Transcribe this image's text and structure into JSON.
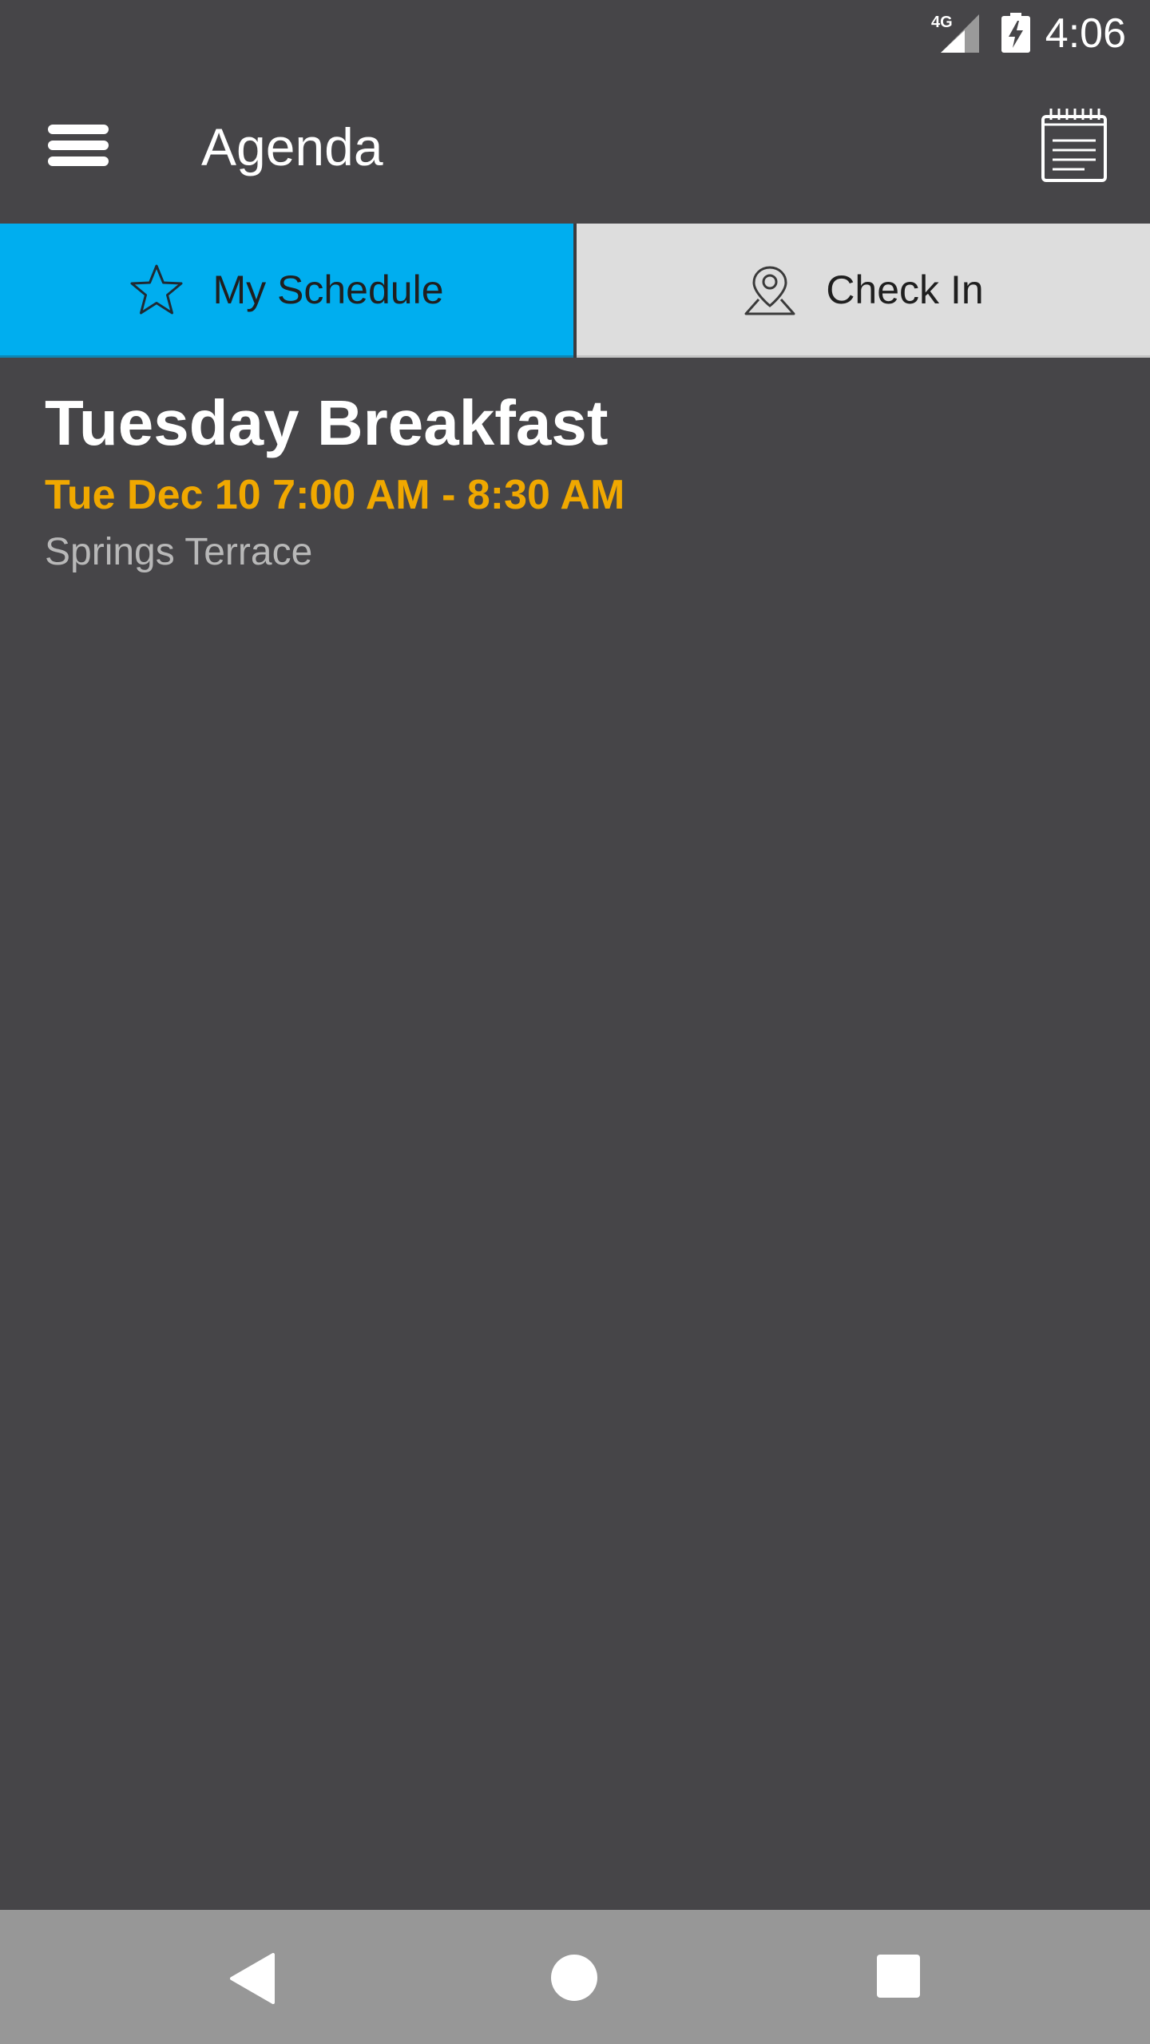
{
  "status_bar": {
    "time": "4:06",
    "network": "4G",
    "battery_icon": "battery-charging-icon",
    "signal_icon": "cell-signal-icon"
  },
  "app_bar": {
    "title": "Agenda",
    "menu_icon": "hamburger-menu-icon",
    "notes_icon": "notepad-icon"
  },
  "tabs": [
    {
      "label": "My Schedule",
      "icon": "star-icon",
      "selected": true
    },
    {
      "label": "Check In",
      "icon": "map-pin-icon",
      "selected": false
    }
  ],
  "events": [
    {
      "title": "Tuesday Breakfast",
      "time": "Tue Dec 10 7:00 AM - 8:30 AM",
      "location": "Springs Terrace"
    }
  ],
  "nav_bar": {
    "back_icon": "back-triangle-icon",
    "home_icon": "home-circle-icon",
    "recents_icon": "recents-square-icon"
  },
  "colors": {
    "background": "#464548",
    "accent_tab": "#00aeef",
    "inactive_tab": "#dddddd",
    "event_time": "#f0a800",
    "location_text": "#b8b8b8",
    "nav_bar": "#979797"
  }
}
